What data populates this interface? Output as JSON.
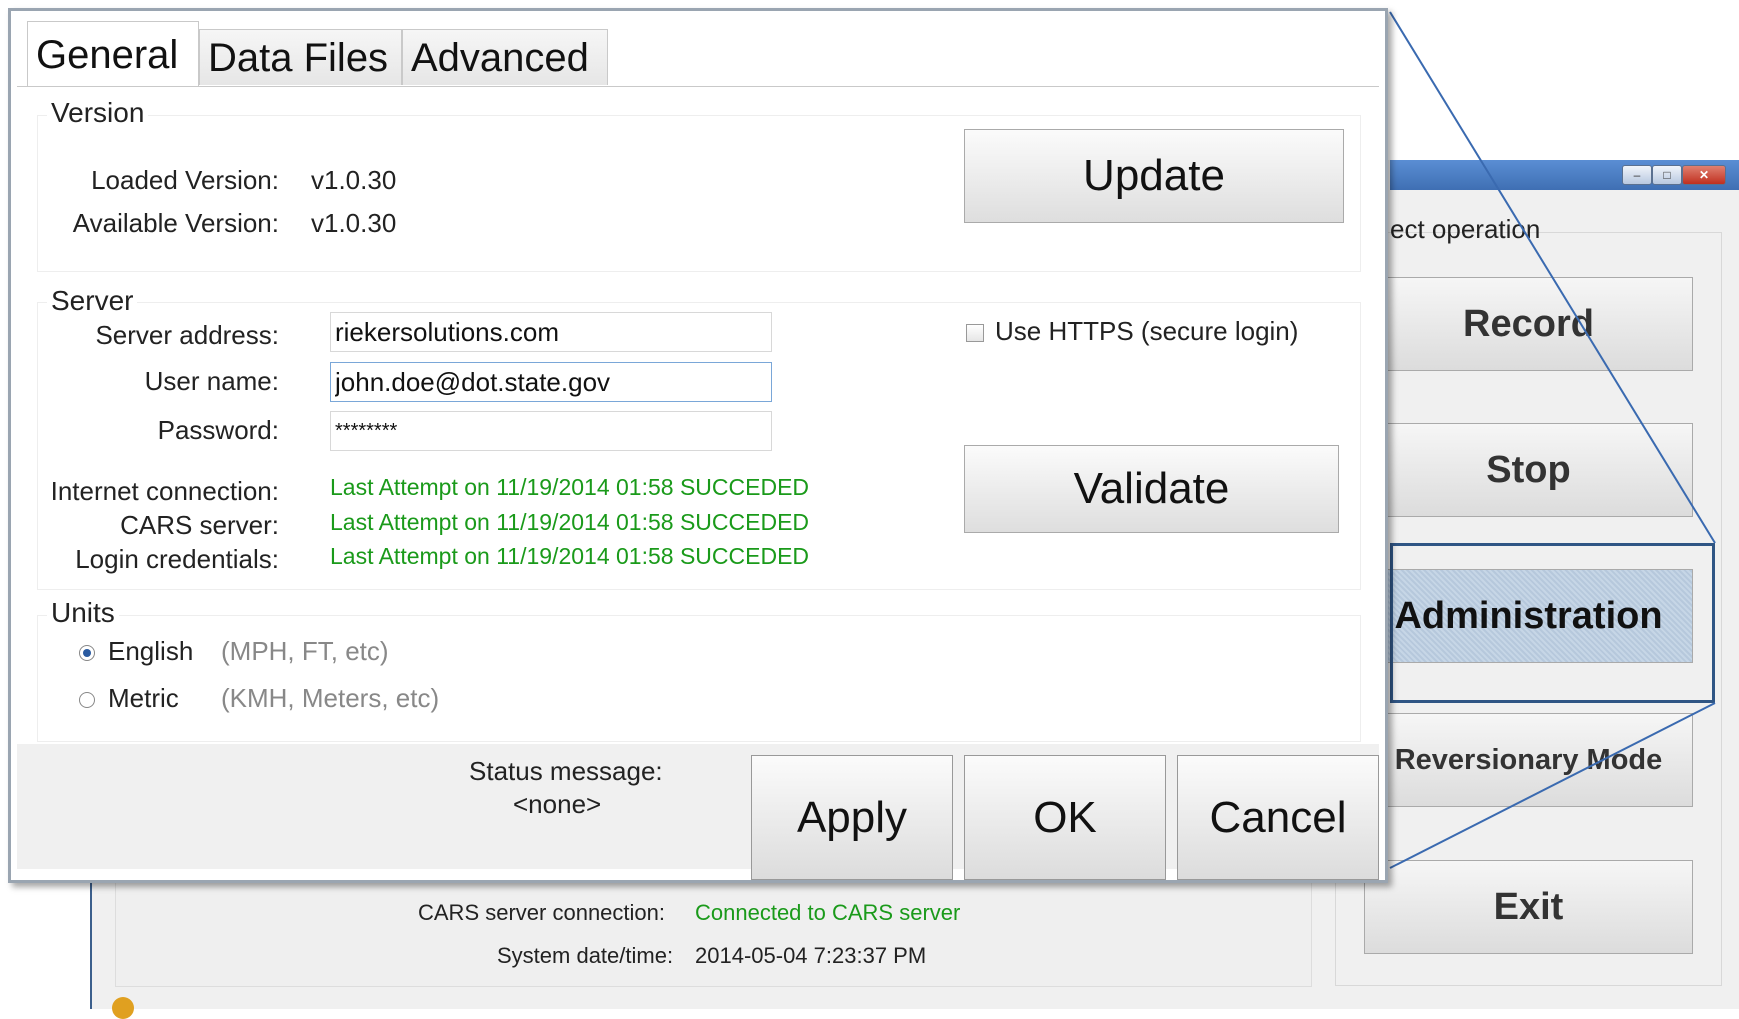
{
  "background_window": {
    "operation_label": "ect operation",
    "buttons": [
      "Record",
      "Stop",
      "Administration",
      "Reversionary Mode",
      "Exit"
    ],
    "cars_server_label": "CARS server connection:",
    "cars_server_value": "Connected to CARS server",
    "system_time_label": "System date/time:",
    "system_time_value": "2014-05-04 7:23:37 PM"
  },
  "dialog": {
    "tabs": [
      "General",
      "Data Files",
      "Advanced"
    ],
    "version": {
      "title": "Version",
      "loaded_label": "Loaded Version:",
      "loaded_value": "v1.0.30",
      "available_label": "Available Version:",
      "available_value": "v1.0.30",
      "update_button": "Update"
    },
    "server": {
      "title": "Server",
      "address_label": "Server address:",
      "address_value": "riekersolutions.com",
      "username_label": "User name:",
      "username_value": "john.doe@dot.state.gov",
      "password_label": "Password:",
      "password_value": "********",
      "https_label": "Use HTTPS (secure login)",
      "internet_label": "Internet connection:",
      "internet_status": "Last Attempt on 11/19/2014 01:58 SUCCEDED",
      "cars_label": "CARS server:",
      "cars_status": "Last Attempt on 11/19/2014 01:58 SUCCEDED",
      "login_label": "Login credentials:",
      "login_status": "Last Attempt on 11/19/2014 01:58 SUCCEDED",
      "validate_button": "Validate"
    },
    "units": {
      "title": "Units",
      "english_label": "English",
      "english_hint": "(MPH, FT, etc)",
      "metric_label": "Metric",
      "metric_hint": "(KMH, Meters, etc)"
    },
    "status_label": "Status message:",
    "status_value": "<none>",
    "apply_button": "Apply",
    "ok_button": "OK",
    "cancel_button": "Cancel"
  },
  "icons": {
    "minimize": "minimize-icon",
    "maximize": "maximize-icon",
    "close": "close-icon"
  }
}
